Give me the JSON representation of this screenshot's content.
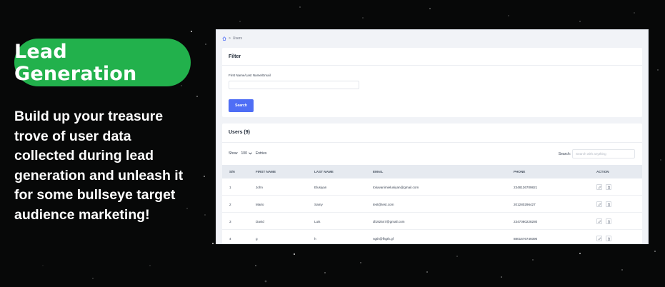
{
  "badge": "Lead Generation",
  "tagline": "Build up your treasure trove of user data collected during lead generation and unleash it for some bullseye target audience marketing!",
  "app": {
    "breadcrumb": {
      "home_icon": "home-icon",
      "separator": ">",
      "current": "Users"
    },
    "filter": {
      "title": "Filter",
      "field_label": "First Name/Last Name/Email",
      "field_value": "",
      "search_button": "Search"
    },
    "users": {
      "title": "Users (9)",
      "show_label": "Show",
      "page_size": "100",
      "entries_label": "Entries",
      "search_label": "Search:",
      "search_placeholder": "Search with anything",
      "columns": [
        "S/N",
        "FIRST NAME",
        "LAST NAME",
        "EMAIL",
        "PHONE",
        "ACTION"
      ],
      "rows": [
        {
          "sn": "1",
          "first": "John",
          "last": "Elusiyan",
          "email": "toluwanimielusiyan@gmail.com",
          "phone": "2348136709821"
        },
        {
          "sn": "2",
          "first": "Mario",
          "last": "Samy",
          "email": "test@test.com",
          "phone": "201280296427"
        },
        {
          "sn": "3",
          "first": "David",
          "last": "Luis",
          "email": "dl192547@gmail.com",
          "phone": "2347080228280"
        },
        {
          "sn": "4",
          "first": "g",
          "last": "h",
          "email": "ngth@fhgth.gf",
          "phone": "8801676749390"
        }
      ],
      "action_icons": [
        "edit-icon",
        "trash-icon"
      ]
    }
  },
  "colors": {
    "background": "#070808",
    "badge_green": "#22b14c",
    "button_blue": "#4f6ef5",
    "table_header": "#e6eaf0"
  }
}
